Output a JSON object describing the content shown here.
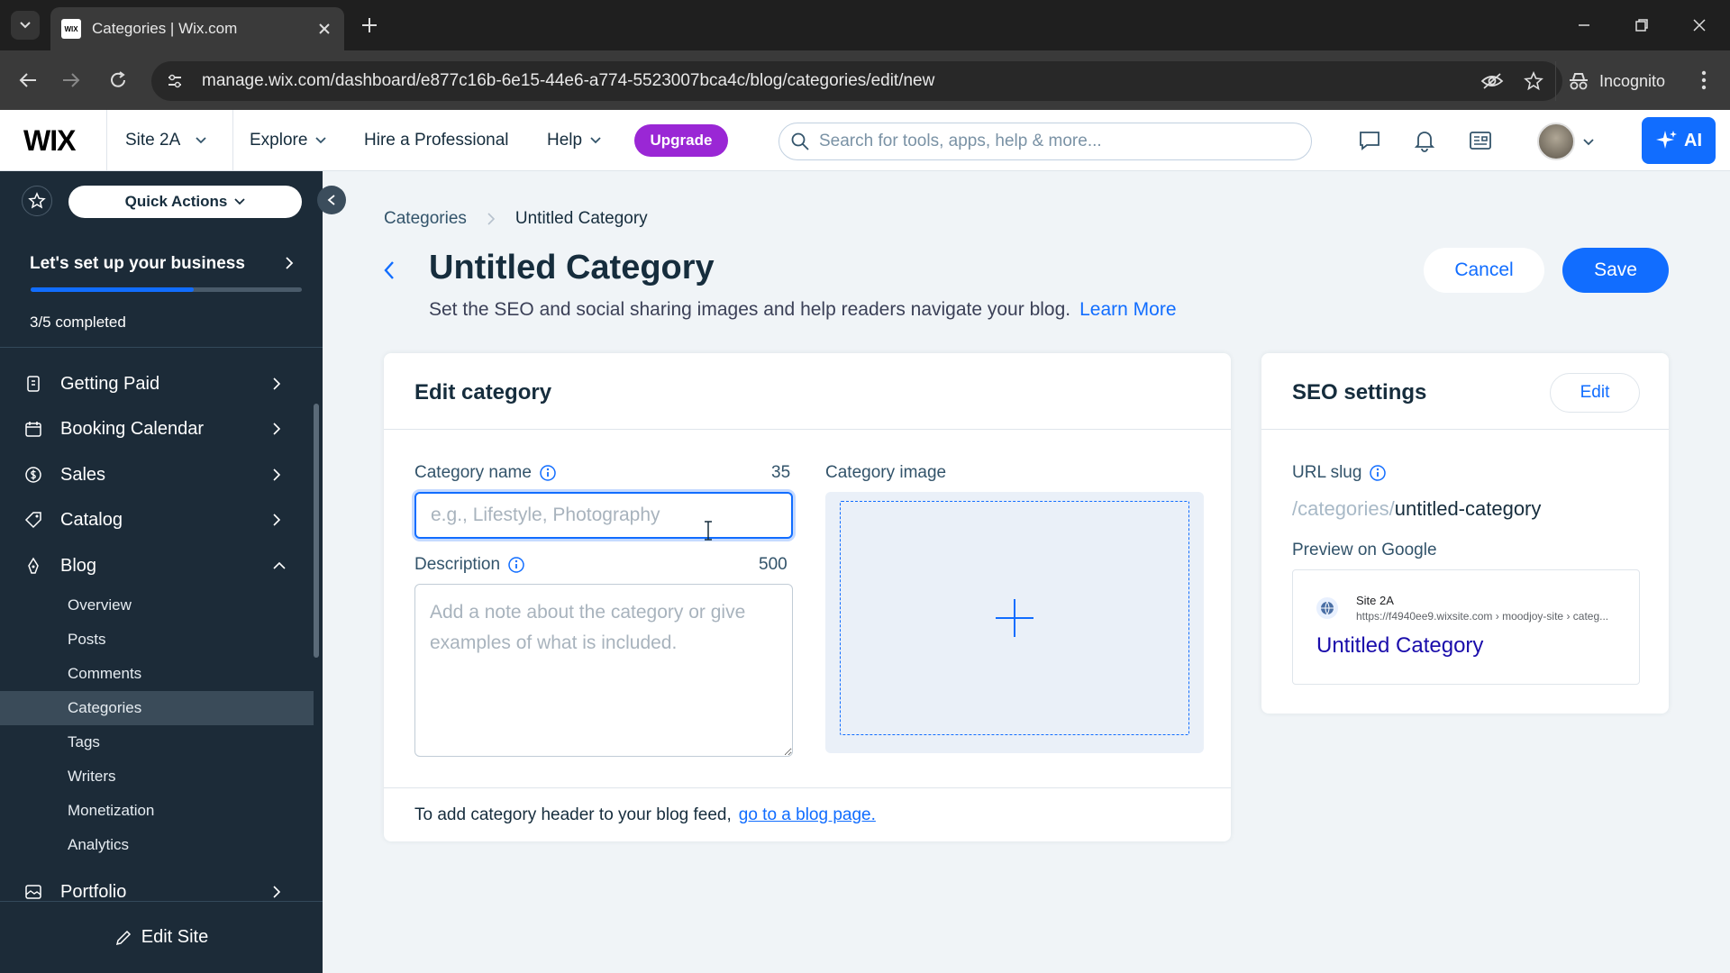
{
  "browser": {
    "tab_title": "Categories | Wix.com",
    "favicon_text": "WIX",
    "url": "manage.wix.com/dashboard/e877c16b-6e15-44e6-a774-5523007bca4c/blog/categories/edit/new",
    "incognito_label": "Incognito"
  },
  "header": {
    "logo": "WIX",
    "site_name": "Site 2A",
    "explore": "Explore",
    "hire": "Hire a Professional",
    "help": "Help",
    "upgrade": "Upgrade",
    "search_placeholder": "Search for tools, apps, help & more...",
    "ai_label": "AI"
  },
  "sidebar": {
    "quick_actions": "Quick Actions",
    "setup_title": "Let's set up your business",
    "setup_progress": 0.6,
    "setup_count": "3/5 completed",
    "items": [
      {
        "label": "Getting Paid",
        "icon": "dollar-doc-icon"
      },
      {
        "label": "Booking Calendar",
        "icon": "calendar-icon"
      },
      {
        "label": "Sales",
        "icon": "dollar-circle-icon"
      },
      {
        "label": "Catalog",
        "icon": "tag-icon"
      },
      {
        "label": "Blog",
        "icon": "pen-nib-icon"
      }
    ],
    "blog_sub": [
      "Overview",
      "Posts",
      "Comments",
      "Categories",
      "Tags",
      "Writers",
      "Monetization",
      "Analytics"
    ],
    "active_sub": "Categories",
    "portfolio": "Portfolio",
    "edit_site": "Edit Site"
  },
  "main": {
    "breadcrumb": [
      "Categories",
      "Untitled Category"
    ],
    "title": "Untitled Category",
    "subtitle": "Set the SEO and social sharing images and help readers navigate your blog.",
    "learn_more": "Learn More",
    "cancel": "Cancel",
    "save": "Save"
  },
  "edit_card": {
    "title": "Edit category",
    "name_label": "Category name",
    "name_limit": "35",
    "name_placeholder": "e.g., Lifestyle, Photography",
    "name_value": "",
    "desc_label": "Description",
    "desc_limit": "500",
    "desc_placeholder": "Add a note about the category or give examples of what is included.",
    "image_label": "Category image",
    "footer_text": "To add category header to your blog feed,",
    "footer_link": "go to a blog page."
  },
  "seo_card": {
    "title": "SEO settings",
    "edit": "Edit",
    "url_slug_label": "URL slug",
    "slug_prefix": "/categories/",
    "slug_value": "untitled-category",
    "preview_label": "Preview on Google",
    "g_site": "Site 2A",
    "g_url": "https://f4940ee9.wixsite.com › moodjoy-site › categ...",
    "g_title": "Untitled Category"
  },
  "colors": {
    "accent": "#116dff",
    "upgrade": "#9a27d5",
    "sidebar_bg": "#1c2b38",
    "page_bg": "#f0f4f7"
  }
}
